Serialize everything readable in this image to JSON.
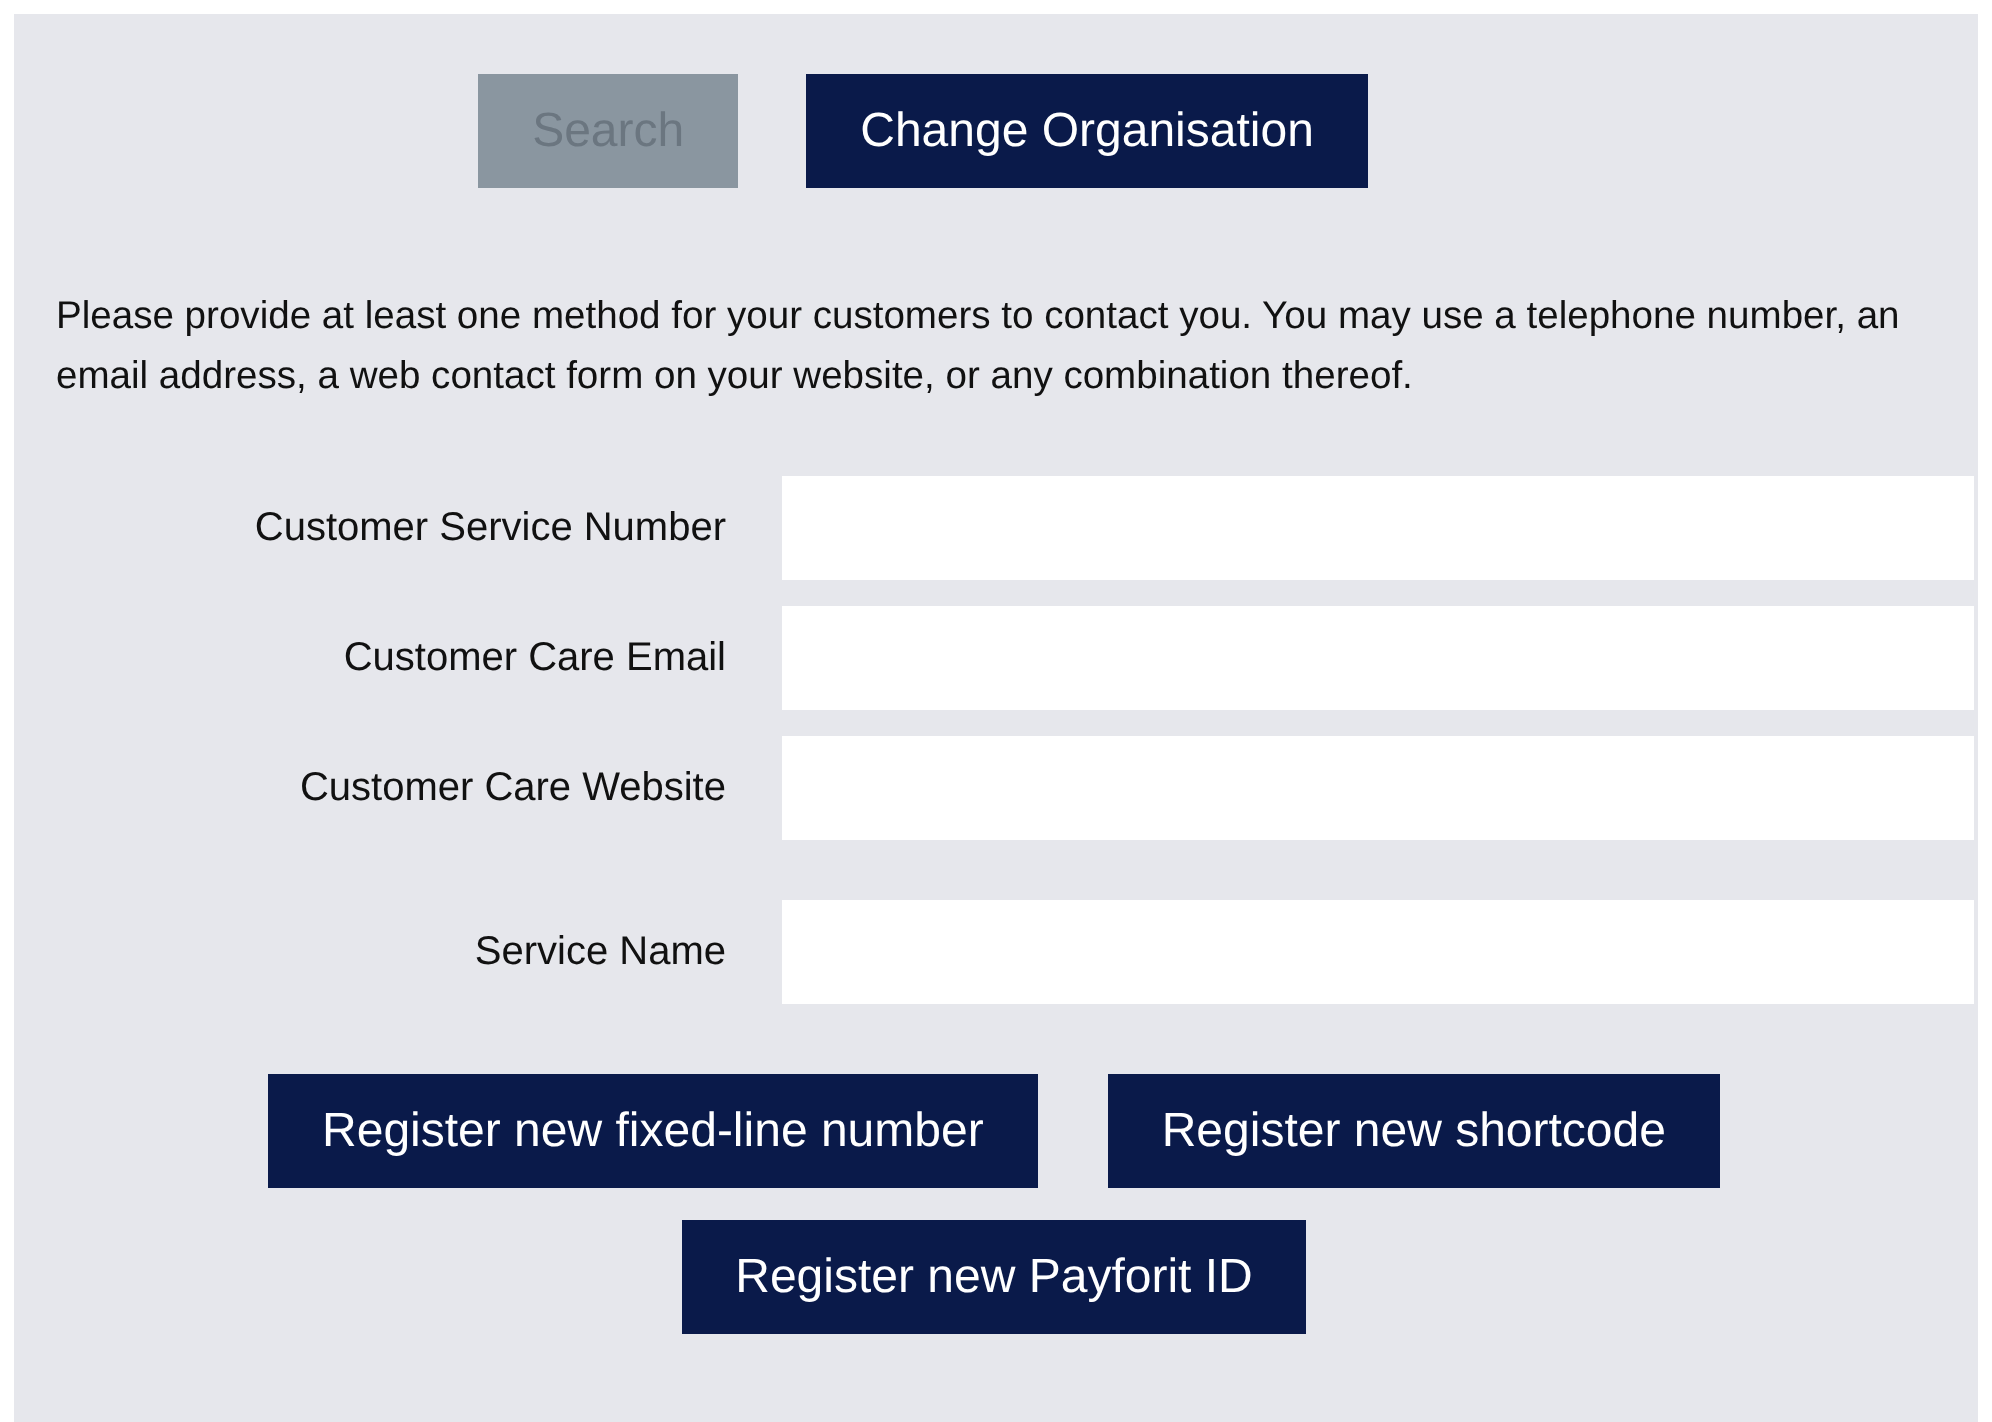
{
  "top_buttons": [
    {
      "label": "Search",
      "disabled": true
    },
    {
      "label": "Change Organisation",
      "disabled": false
    }
  ],
  "instructions": "Please provide at least one method for your customers to contact you. You may use a telephone number, an email address, a web contact form on your website, or any combination thereof.",
  "contact_fields": [
    {
      "label": "Customer Service Number"
    },
    {
      "label": "Customer Care Email"
    },
    {
      "label": "Customer Care Website"
    }
  ],
  "service_fields": [
    {
      "label": "Service Name"
    }
  ],
  "register_buttons": [
    {
      "label": "Register new fixed-line number"
    },
    {
      "label": "Register new shortcode"
    },
    {
      "label": "Register new Payforit ID"
    }
  ]
}
